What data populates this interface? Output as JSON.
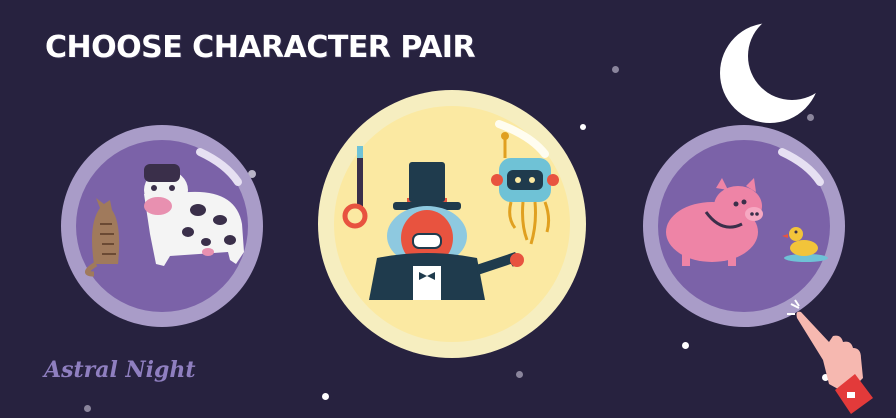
{
  "title": "CHOOSE CHARACTER PAIR",
  "logo": "Astral Night",
  "colors": {
    "background": "#27223f",
    "bubble_side_ring": "#a99cc8",
    "bubble_side_inner": "#7b62a8",
    "bubble_center_ring": "#f6eec0",
    "bubble_center_inner": "#fbe9a2",
    "moon": "#ffffff"
  },
  "pairs": [
    {
      "id": "pair-left",
      "characters": [
        "cat",
        "cow"
      ],
      "icons": [
        "cat-icon",
        "cow-icon"
      ]
    },
    {
      "id": "pair-center",
      "characters": [
        "magician",
        "robot"
      ],
      "icons": [
        "magician-icon",
        "robot-icon"
      ]
    },
    {
      "id": "pair-right",
      "characters": [
        "pig",
        "duck"
      ],
      "icons": [
        "pig-icon",
        "duck-icon"
      ]
    }
  ],
  "icons": {
    "moon": "crescent-moon-icon",
    "pointer": "pointing-hand-icon"
  }
}
